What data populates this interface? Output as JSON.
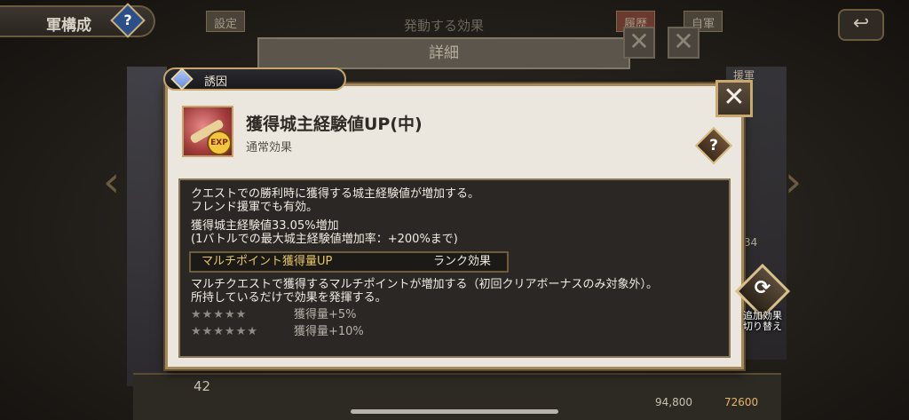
{
  "background": {
    "header_title": "軍構成",
    "help_symbol": "?",
    "tab_settings": "設定",
    "center_title": "発動する効果",
    "detail_label": "詳細",
    "tab_history": "履歴",
    "tab_own_army": "自軍",
    "back_symbol": "↩",
    "close_symbol": "✕",
    "reinforcement_label": "援軍",
    "bottom_value_left": "42",
    "bottom_value_mid": "94,800",
    "bottom_value_right": "72600",
    "right_num": "34"
  },
  "modal": {
    "tag_label": "誘因",
    "close_symbol": "✕",
    "title": "獲得城主経験値UP(中)",
    "subtitle": "通常効果",
    "help_symbol": "?",
    "icon_badge": "EXP",
    "description": {
      "line1": "クエストでの勝利時に獲得する城主経験値が増加する。",
      "line2": "フレンド援軍でも有効。",
      "line3": "獲得城主経験値33.05%増加",
      "line4": "(1バトルでの最大城主経験値増加率：+200%まで)"
    },
    "sub_effect": {
      "name": "マルチポイント獲得量UP",
      "rank_label": "ランク効果",
      "line1": "マルチクエストで獲得するマルチポイントが増加する（初回クリアボーナスのみ対象外）。",
      "line2": "所持しているだけで効果を発揮する。",
      "tiers": [
        {
          "stars": "★★★★★",
          "effect": "獲得量+5%"
        },
        {
          "stars": "★★★★★★",
          "effect": "獲得量+10%"
        }
      ]
    }
  },
  "switch_button": {
    "icon": "⟳",
    "label_line1": "追加効果",
    "label_line2": "切り替え"
  }
}
